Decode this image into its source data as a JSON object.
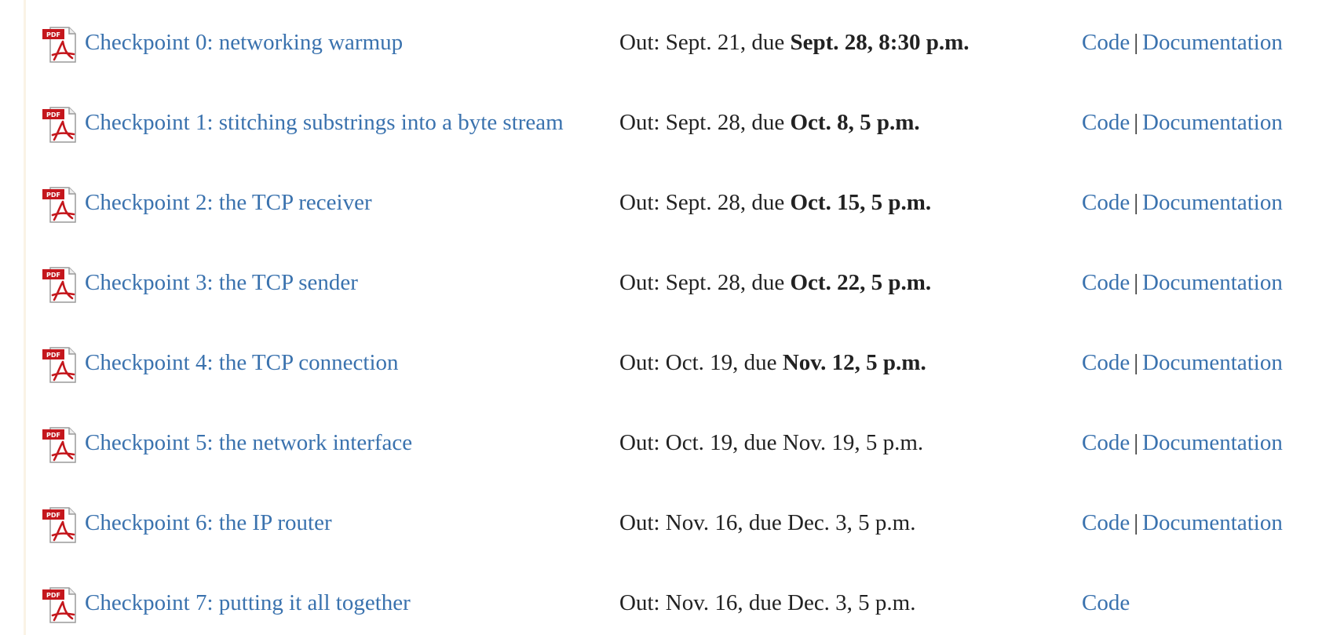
{
  "icon": {
    "name": "pdf-icon",
    "badge": "PDF"
  },
  "colors": {
    "link": "#3a72ae",
    "text": "#222222",
    "pdf_red": "#c4161c"
  },
  "separator": "|",
  "rows": [
    {
      "title": "Checkpoint 0: networking warmup",
      "out": "Out: Sept. 21, due ",
      "due": "Sept. 28, 8:30 p.m.",
      "due_bold": true,
      "code": "Code",
      "docs": "Documentation"
    },
    {
      "title": "Checkpoint 1: stitching substrings into a byte stream",
      "out": "Out: Sept. 28, due ",
      "due": "Oct. 8, 5 p.m.",
      "due_bold": true,
      "code": "Code",
      "docs": "Documentation"
    },
    {
      "title": "Checkpoint 2: the TCP receiver",
      "out": "Out: Sept. 28, due ",
      "due": "Oct. 15, 5 p.m.",
      "due_bold": true,
      "code": "Code",
      "docs": "Documentation"
    },
    {
      "title": "Checkpoint 3: the TCP sender",
      "out": "Out: Sept. 28, due ",
      "due": "Oct. 22, 5 p.m.",
      "due_bold": true,
      "code": "Code",
      "docs": "Documentation"
    },
    {
      "title": "Checkpoint 4: the TCP connection",
      "out": "Out: Oct. 19, due ",
      "due": "Nov. 12, 5 p.m.",
      "due_bold": true,
      "code": "Code",
      "docs": "Documentation"
    },
    {
      "title": "Checkpoint 5: the network interface",
      "out": "Out: Oct. 19, due ",
      "due": "Nov. 19, 5 p.m.",
      "due_bold": false,
      "code": "Code",
      "docs": "Documentation"
    },
    {
      "title": "Checkpoint 6: the IP router",
      "out": "Out: Nov. 16, due ",
      "due": "Dec. 3, 5 p.m.",
      "due_bold": false,
      "code": "Code",
      "docs": "Documentation"
    },
    {
      "title": "Checkpoint 7: putting it all together",
      "out": "Out: Nov. 16, due ",
      "due": "Dec. 3, 5 p.m.",
      "due_bold": false,
      "code": "Code",
      "docs": ""
    }
  ]
}
